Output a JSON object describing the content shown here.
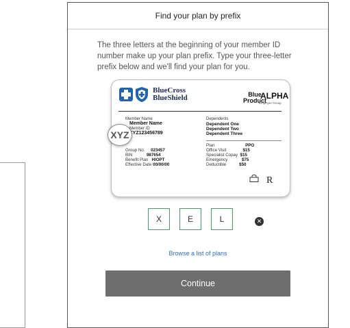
{
  "modal": {
    "title": "Find your plan by prefix",
    "intro": "The three letters at the beginning of your member ID number make up your plan prefix. Type your three-letter prefix below and we'll find your plan for you.",
    "continue_label": "Continue",
    "browse_link": "Browse a list of plans"
  },
  "card": {
    "brand_line1": "BlueCross",
    "brand_line2": "BlueShield",
    "product_line1": "Blue",
    "product_line2": "Product",
    "alpha": "ALPHA",
    "alpha_sub": "Employer Group",
    "member_name_label": "Member Name",
    "member_name": "Member Name",
    "member_id_label": "Member ID",
    "member_id": "XYZ123456789",
    "prefix_highlight": "XYZ",
    "left_fields": [
      {
        "label": "Group No.",
        "value": "023457"
      },
      {
        "label": "BIN",
        "value": "987654"
      },
      {
        "label": "Benefit Plan",
        "value": "HIOPT"
      },
      {
        "label": "Effective Date",
        "value": "00/00/00"
      }
    ],
    "dependents_label": "Dependents",
    "dependents": [
      "Dependent One",
      "Dependent Two",
      "Dependent Three"
    ],
    "right_fields": [
      {
        "label": "Plan",
        "value": "PPO"
      },
      {
        "label": "Office Visit",
        "value": "$15"
      },
      {
        "label": "Specialist Copay",
        "value": "$15"
      },
      {
        "label": "Emergency",
        "value": "$75"
      },
      {
        "label": "Deductible",
        "value": "$50"
      }
    ],
    "rx_mark": "R"
  },
  "prefix_inputs": [
    "X",
    "E",
    "L"
  ],
  "icons": {
    "clear": "clear-circle-x-icon",
    "cross_logo": "blue-cross-logo-icon",
    "shield_logo": "blue-shield-logo-icon",
    "lock": "lock-icon"
  },
  "colors": {
    "input_border": "#4a9a63",
    "link": "#2f6fb0",
    "button_bg": "#6e6e6e",
    "brand_blue": "#1f64ad"
  }
}
